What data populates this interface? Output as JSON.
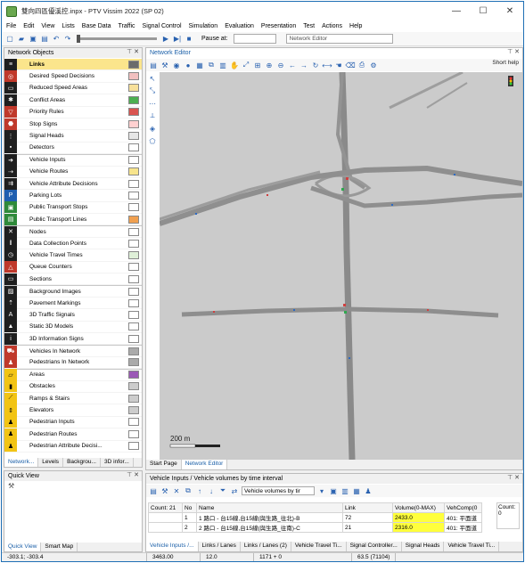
{
  "window": {
    "title": "雙向四區優溪控.inpx - PTV Vissim 2022 (SP 02)",
    "controls": [
      "—",
      "☐",
      "✕"
    ]
  },
  "menu": [
    "File",
    "Edit",
    "View",
    "Lists",
    "Base Data",
    "Traffic",
    "Signal Control",
    "Simulation",
    "Evaluation",
    "Presentation",
    "Test",
    "Actions",
    "Help"
  ],
  "toolbar": {
    "pause_label": "Pause at:",
    "pause_value": "",
    "editor_select": "Network Editor"
  },
  "network_objects": {
    "title": "Network Objects",
    "items": [
      {
        "label": "Links",
        "icon": "links-icon",
        "glyph": "≡",
        "color": "dark",
        "selected": true,
        "bold": true,
        "swatch": "#6b6b6b",
        "sep": false
      },
      {
        "label": "Desired Speed Decisions",
        "icon": "desired-speed-icon",
        "glyph": "◎",
        "color": "red",
        "selected": false,
        "bold": false,
        "swatch": "#f2c0c0",
        "sep": false
      },
      {
        "label": "Reduced Speed Areas",
        "icon": "reduced-speed-icon",
        "glyph": "▭",
        "color": "dark",
        "selected": false,
        "bold": false,
        "swatch": "#f7e09a",
        "sep": false
      },
      {
        "label": "Conflict Areas",
        "icon": "conflict-area-icon",
        "glyph": "✱",
        "color": "dark",
        "selected": false,
        "bold": false,
        "swatch": "#4caf50",
        "sep": false
      },
      {
        "label": "Priority Rules",
        "icon": "priority-rule-icon",
        "glyph": "▽",
        "color": "red",
        "selected": false,
        "bold": false,
        "swatch": "#d9534f",
        "sep": false
      },
      {
        "label": "Stop Signs",
        "icon": "stop-sign-icon",
        "glyph": "⬣",
        "color": "red",
        "selected": false,
        "bold": false,
        "swatch": "#ffd0d0",
        "sep": false
      },
      {
        "label": "Signal Heads",
        "icon": "signal-head-icon",
        "glyph": "⋮",
        "color": "dark",
        "selected": false,
        "bold": false,
        "swatch": "#e6e6e6",
        "sep": false
      },
      {
        "label": "Detectors",
        "icon": "detector-icon",
        "glyph": "▪",
        "color": "dark",
        "selected": false,
        "bold": false,
        "swatch": "#ffffff",
        "sep": false
      },
      {
        "label": "Vehicle Inputs",
        "icon": "vehicle-input-icon",
        "glyph": "➜",
        "color": "dark",
        "selected": false,
        "bold": false,
        "swatch": "#ffffff",
        "sep": true
      },
      {
        "label": "Vehicle Routes",
        "icon": "vehicle-route-icon",
        "glyph": "⇢",
        "color": "dark",
        "selected": false,
        "bold": false,
        "swatch": "#f7e48c",
        "sep": false
      },
      {
        "label": "Vehicle Attribute Decisions",
        "icon": "attribute-decision-icon",
        "glyph": "⇉",
        "color": "dark",
        "selected": false,
        "bold": false,
        "swatch": "#ffffff",
        "sep": false
      },
      {
        "label": "Parking Lots",
        "icon": "parking-lot-icon",
        "glyph": "P",
        "color": "blue",
        "selected": false,
        "bold": false,
        "swatch": "#ffffff",
        "sep": false
      },
      {
        "label": "Public Transport Stops",
        "icon": "pt-stop-icon",
        "glyph": "▣",
        "color": "green",
        "selected": false,
        "bold": false,
        "swatch": "#ffffff",
        "sep": false
      },
      {
        "label": "Public Transport Lines",
        "icon": "pt-line-icon",
        "glyph": "▤",
        "color": "green",
        "selected": false,
        "bold": false,
        "swatch": "#f0a050",
        "sep": false
      },
      {
        "label": "Nodes",
        "icon": "node-icon",
        "glyph": "✕",
        "color": "dark",
        "selected": false,
        "bold": false,
        "swatch": "#ffffff",
        "sep": true
      },
      {
        "label": "Data Collection Points",
        "icon": "data-collection-icon",
        "glyph": "‖",
        "color": "dark",
        "selected": false,
        "bold": false,
        "swatch": "#ffffff",
        "sep": false
      },
      {
        "label": "Vehicle Travel Times",
        "icon": "travel-time-icon",
        "glyph": "◷",
        "color": "dark",
        "selected": false,
        "bold": false,
        "swatch": "#dff0d8",
        "sep": false
      },
      {
        "label": "Queue Counters",
        "icon": "queue-counter-icon",
        "glyph": "△",
        "color": "red",
        "selected": false,
        "bold": false,
        "swatch": "#ffffff",
        "sep": false
      },
      {
        "label": "Sections",
        "icon": "section-icon",
        "glyph": "▭",
        "color": "dark",
        "selected": false,
        "bold": false,
        "swatch": "#ffffff",
        "sep": false
      },
      {
        "label": "Background Images",
        "icon": "background-image-icon",
        "glyph": "▨",
        "color": "dark",
        "selected": false,
        "bold": false,
        "swatch": "#ffffff",
        "sep": true
      },
      {
        "label": "Pavement Markings",
        "icon": "pavement-marking-icon",
        "glyph": "⇡",
        "color": "dark",
        "selected": false,
        "bold": false,
        "swatch": "#ffffff",
        "sep": false
      },
      {
        "label": "3D Traffic Signals",
        "icon": "traffic-signal-3d-icon",
        "glyph": "A",
        "color": "dark",
        "selected": false,
        "bold": false,
        "swatch": "#ffffff",
        "sep": false
      },
      {
        "label": "Static 3D Models",
        "icon": "static-3d-icon",
        "glyph": "▲",
        "color": "dark",
        "selected": false,
        "bold": false,
        "swatch": "#ffffff",
        "sep": false
      },
      {
        "label": "3D Information Signs",
        "icon": "info-sign-icon",
        "glyph": "i",
        "color": "dark",
        "selected": false,
        "bold": false,
        "swatch": "#ffffff",
        "sep": false
      },
      {
        "label": "Vehicles In Network",
        "icon": "vehicle-in-network-icon",
        "glyph": "⛟",
        "color": "red",
        "selected": false,
        "bold": false,
        "swatch": "#aaaaaa",
        "sep": true
      },
      {
        "label": "Pedestrians In Network",
        "icon": "pedestrian-in-network-icon",
        "glyph": "♟",
        "color": "red",
        "selected": false,
        "bold": false,
        "swatch": "#aaaaaa",
        "sep": false
      },
      {
        "label": "Areas",
        "icon": "area-icon",
        "glyph": "▱",
        "color": "yellow",
        "selected": false,
        "bold": false,
        "swatch": "#9b59b6",
        "sep": true
      },
      {
        "label": "Obstacles",
        "icon": "obstacle-icon",
        "glyph": "▮",
        "color": "yellow",
        "selected": false,
        "bold": false,
        "swatch": "#cccccc",
        "sep": false
      },
      {
        "label": "Ramps & Stairs",
        "icon": "ramp-icon",
        "glyph": "⟋",
        "color": "yellow",
        "selected": false,
        "bold": false,
        "swatch": "#cccccc",
        "sep": false
      },
      {
        "label": "Elevators",
        "icon": "elevator-icon",
        "glyph": "⇕",
        "color": "yellow",
        "selected": false,
        "bold": false,
        "swatch": "#cccccc",
        "sep": false
      },
      {
        "label": "Pedestrian Inputs",
        "icon": "pedestrian-input-icon",
        "glyph": "♟",
        "color": "yellow",
        "selected": false,
        "bold": false,
        "swatch": "#ffffff",
        "sep": false
      },
      {
        "label": "Pedestrian Routes",
        "icon": "pedestrian-route-icon",
        "glyph": "♟",
        "color": "yellow",
        "selected": false,
        "bold": false,
        "swatch": "#ffffff",
        "sep": false
      },
      {
        "label": "Pedestrian Attribute Decisi...",
        "icon": "pedestrian-attribute-icon",
        "glyph": "♟",
        "color": "yellow",
        "selected": false,
        "bold": false,
        "swatch": "#ffffff",
        "sep": false
      }
    ],
    "tabs": [
      "Network...",
      "Levels",
      "Backgrou...",
      "3D infor..."
    ]
  },
  "quick_view": {
    "title": "Quick View",
    "tabs": [
      "Quick View",
      "Smart Map"
    ]
  },
  "network_editor": {
    "title": "Network Editor",
    "short_help": "Short help",
    "scale_label": "200 m",
    "tabs": [
      "Start Page",
      "Network Editor"
    ]
  },
  "vehicle_inputs": {
    "title": "Vehicle Inputs / Vehicle volumes by time interval",
    "select_value": "Vehicle volumes by tir",
    "columns": [
      "Count: 21",
      "No",
      "Name",
      "Link",
      "Volume(0-MAX)",
      "VehComp(0"
    ],
    "rows": [
      {
        "idx": "",
        "no": "1",
        "name": "1 路口 - 台15線,台15線(與生路_往北)-B",
        "link": "72",
        "volume": "2433.0",
        "vehcomp": "401: 平面道"
      },
      {
        "idx": "",
        "no": "2",
        "name": "2 路口 - 台15線,台15線(與生路_往南)-C",
        "link": "21",
        "volume": "2316.0",
        "vehcomp": "401: 平面道"
      }
    ],
    "count_box": "Count: 0",
    "tabs": [
      "Vehicle Inputs /...",
      "Links / Lanes",
      "Links / Lanes (2)",
      "Vehicle Travel Ti...",
      "Signal Controller...",
      "Signal Heads",
      "Vehicle Travel Ti..."
    ]
  },
  "status": {
    "coords": "-303.1; -303.4",
    "val1": "3463.00",
    "val2": "12.0",
    "val3": "1171 + 0",
    "val4": "63.5 (71104)"
  }
}
